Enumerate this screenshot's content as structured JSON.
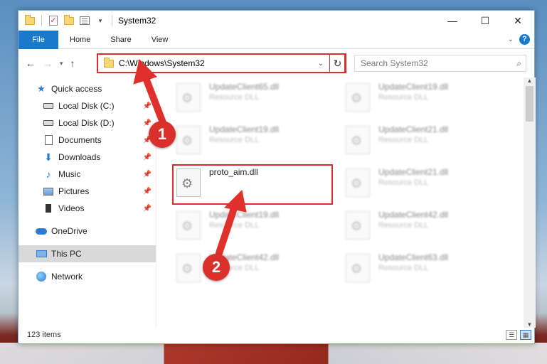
{
  "window": {
    "title": "System32",
    "controls": {
      "minimize": "—",
      "maximize": "☐",
      "close": "✕"
    }
  },
  "ribbon": {
    "file_tab": "File",
    "tabs": [
      "Home",
      "Share",
      "View"
    ],
    "help": "?"
  },
  "address_bar": {
    "path": "C:\\Windows\\System32",
    "dropdown": "⌄",
    "refresh": "↻"
  },
  "search": {
    "placeholder": "Search System32",
    "icon": "search-icon"
  },
  "sidebar": {
    "items": [
      {
        "label": "Quick access",
        "icon": "star-icon"
      },
      {
        "label": "Local Disk (C:)",
        "icon": "drive-icon",
        "pinned": true
      },
      {
        "label": "Local Disk (D:)",
        "icon": "drive-icon",
        "pinned": true
      },
      {
        "label": "Documents",
        "icon": "document-icon",
        "pinned": true
      },
      {
        "label": "Downloads",
        "icon": "download-icon",
        "pinned": true
      },
      {
        "label": "Music",
        "icon": "music-icon",
        "pinned": true
      },
      {
        "label": "Pictures",
        "icon": "pictures-icon",
        "pinned": true
      },
      {
        "label": "Videos",
        "icon": "video-icon",
        "pinned": true
      },
      {
        "label": "OneDrive",
        "icon": "cloud-icon"
      },
      {
        "label": "This PC",
        "icon": "computer-icon",
        "selected": true
      },
      {
        "label": "Network",
        "icon": "network-icon"
      }
    ]
  },
  "files": [
    {
      "name": "UpdateClient65.dll",
      "type": "Resource DLL",
      "blurred": true
    },
    {
      "name": "UpdateClient19.dll",
      "type": "Resource DLL",
      "blurred": true
    },
    {
      "name": "UpdateClient19.dll",
      "type": "Resource DLL",
      "blurred": true
    },
    {
      "name": "UpdateClient21.dll",
      "type": "Resource DLL",
      "blurred": true
    },
    {
      "name": "proto_aim.dll",
      "type": "",
      "blurred": false
    },
    {
      "name": "UpdateClient21.dll",
      "type": "Resource DLL",
      "blurred": true
    },
    {
      "name": "UpdateClient19.dll",
      "type": "Resource DLL",
      "blurred": true
    },
    {
      "name": "UpdateClient42.dll",
      "type": "Resource DLL",
      "blurred": true
    },
    {
      "name": "UpdateClient42.dll",
      "type": "Resource DLL",
      "blurred": true
    },
    {
      "name": "UpdateClient63.dll",
      "type": "Resource DLL",
      "blurred": true
    }
  ],
  "status": {
    "item_count": "123 items"
  },
  "callouts": {
    "step1": "1",
    "step2": "2"
  },
  "colors": {
    "accent": "#1979ca",
    "highlight": "#d9302c"
  }
}
